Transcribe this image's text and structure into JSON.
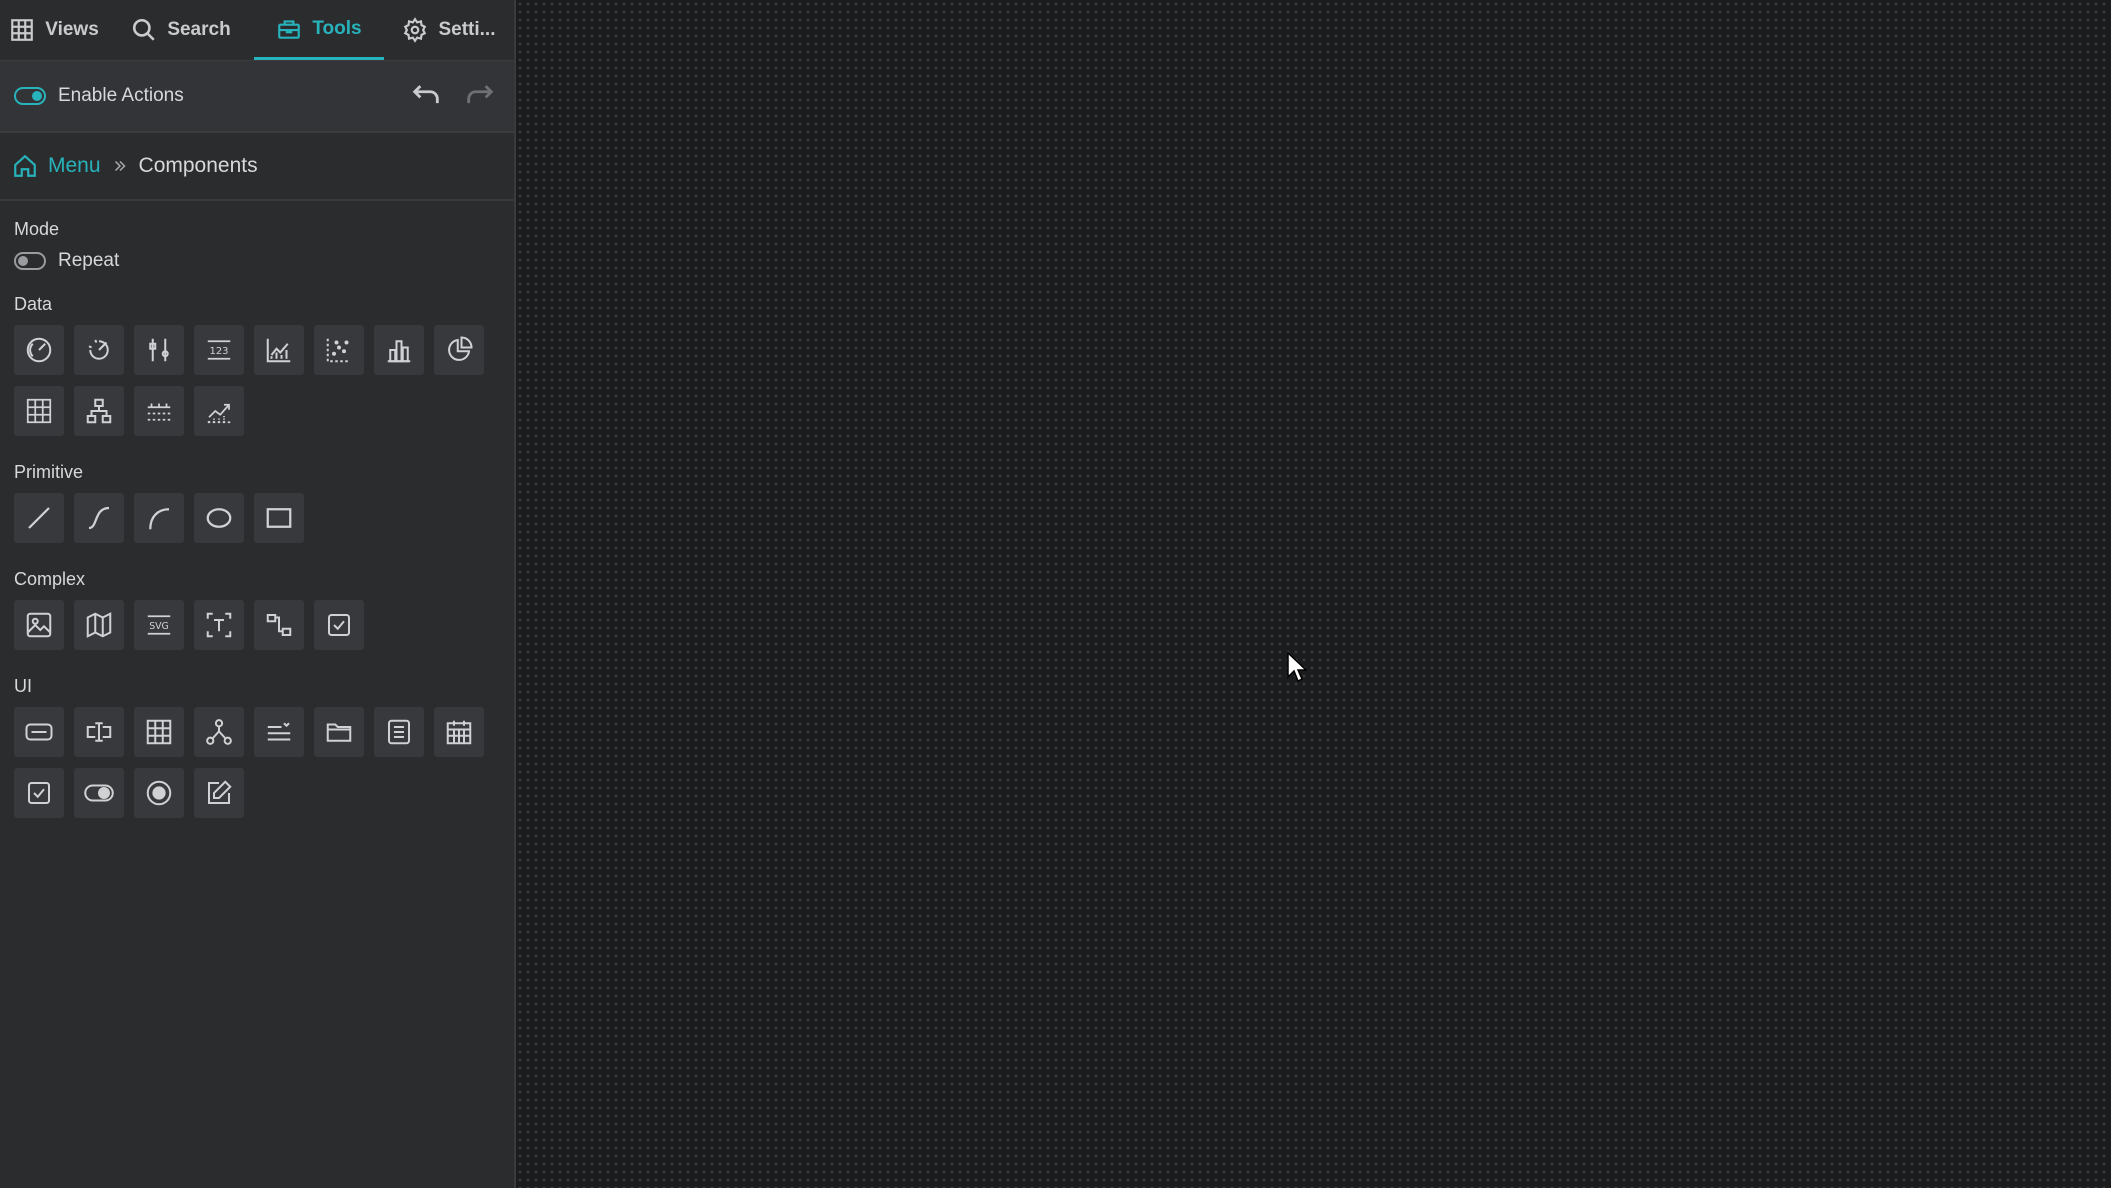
{
  "tabs": [
    {
      "label": "Views",
      "icon": "grid-icon"
    },
    {
      "label": "Search",
      "icon": "search-icon"
    },
    {
      "label": "Tools",
      "icon": "toolbox-icon"
    },
    {
      "label": "Setti...",
      "icon": "gear-icon"
    }
  ],
  "active_tab": "Tools",
  "actions": {
    "label": "Enable Actions",
    "enabled": true
  },
  "breadcrumb": {
    "home": "Menu",
    "current": "Components"
  },
  "mode": {
    "label": "Mode",
    "repeat_label": "Repeat",
    "repeat_enabled": false
  },
  "sections": {
    "data": {
      "label": "Data",
      "tools": [
        "gauge-icon",
        "radial-gauge-icon",
        "sliders-icon",
        "number-icon",
        "line-chart-icon",
        "scatter-chart-icon",
        "bar-chart-icon",
        "pie-chart-icon",
        "heatmap-icon",
        "tree-icon",
        "timeline-icon",
        "area-chart-icon"
      ]
    },
    "primitive": {
      "label": "Primitive",
      "tools": [
        "line-icon",
        "curve-icon",
        "arc-icon",
        "ellipse-icon",
        "rectangle-icon"
      ]
    },
    "complex": {
      "label": "Complex",
      "tools": [
        "image-icon",
        "map-icon",
        "svg-icon",
        "text-frame-icon",
        "connector-icon",
        "checklist-icon"
      ]
    },
    "ui": {
      "label": "UI",
      "tools": [
        "input-box-icon",
        "text-cursor-icon",
        "table-icon",
        "hierarchy-icon",
        "list-filter-icon",
        "folder-icon",
        "document-list-icon",
        "calendar-icon",
        "checkbox-icon",
        "toggle-icon",
        "radio-icon",
        "edit-icon"
      ]
    }
  },
  "colors": {
    "accent": "#27b3bb",
    "sidebar": "#2b2c2e",
    "canvas": "#1b1c1e"
  }
}
